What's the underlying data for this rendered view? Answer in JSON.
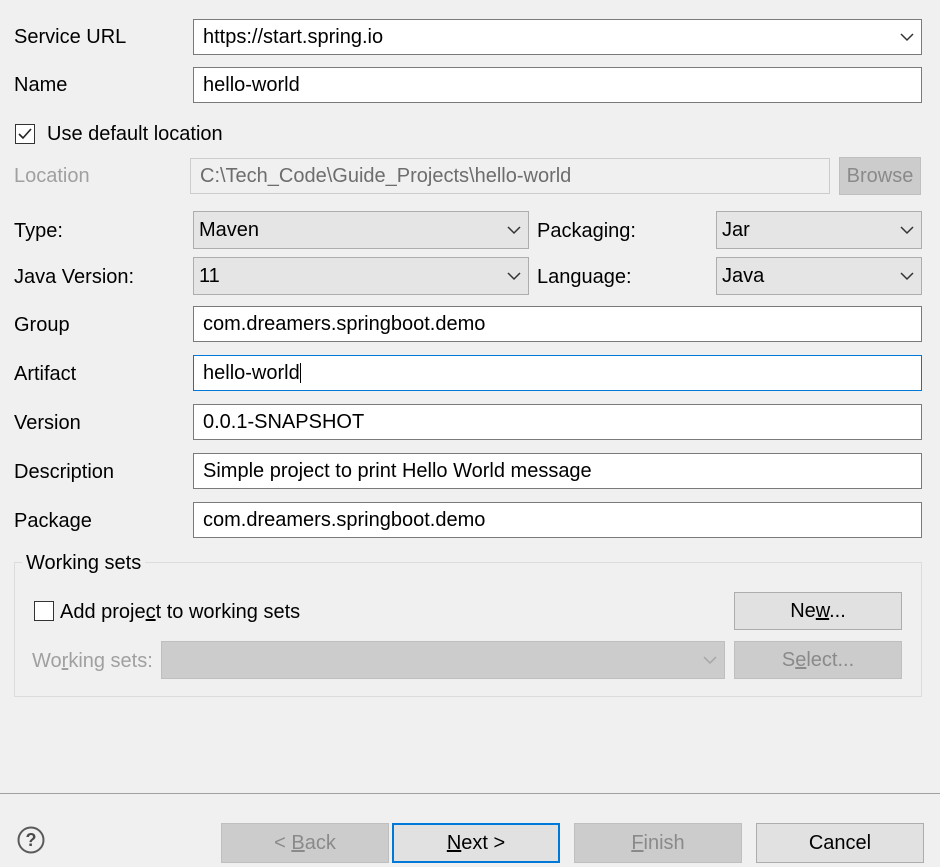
{
  "form": {
    "service_url": {
      "label": "Service URL",
      "value": "https://start.spring.io"
    },
    "name": {
      "label": "Name",
      "value": "hello-world"
    },
    "use_default_location": {
      "label": "Use default location",
      "checked": true
    },
    "location": {
      "label": "Location",
      "value": "C:\\Tech_Code\\Guide_Projects\\hello-world",
      "browse_label": "Browse"
    },
    "type": {
      "label": "Type:",
      "value": "Maven"
    },
    "packaging": {
      "label": "Packaging:",
      "value": "Jar"
    },
    "java_version": {
      "label": "Java Version:",
      "value": "11"
    },
    "language": {
      "label": "Language:",
      "value": "Java"
    },
    "group": {
      "label": "Group",
      "value": "com.dreamers.springboot.demo"
    },
    "artifact": {
      "label": "Artifact",
      "value": "hello-world"
    },
    "version": {
      "label": "Version",
      "value": "0.0.1-SNAPSHOT"
    },
    "description": {
      "label": "Description",
      "value": "Simple project to print Hello World message"
    },
    "package": {
      "label": "Package",
      "value": "com.dreamers.springboot.demo"
    }
  },
  "working_sets": {
    "title": "Working sets",
    "add_to_sets": {
      "label_pre": "Add proje",
      "label_mn": "c",
      "label_post": "t to working sets",
      "checked": false
    },
    "new_button": {
      "pre": "Ne",
      "mn": "w",
      "post": "..."
    },
    "sets_label": {
      "pre": "Wo",
      "mn": "r",
      "post": "king sets:"
    },
    "select_button": {
      "pre": "S",
      "mn": "e",
      "post": "lect..."
    }
  },
  "footer": {
    "help_icon": "help-question-icon",
    "back": {
      "pre": "< ",
      "mn": "B",
      "post": "ack"
    },
    "next": {
      "pre": "",
      "mn": "N",
      "post": "ext >"
    },
    "finish": {
      "pre": "",
      "mn": "F",
      "post": "inish"
    },
    "cancel": "Cancel"
  },
  "colors": {
    "focus": "#0078d7",
    "disabled_text": "#a0a0a0"
  }
}
